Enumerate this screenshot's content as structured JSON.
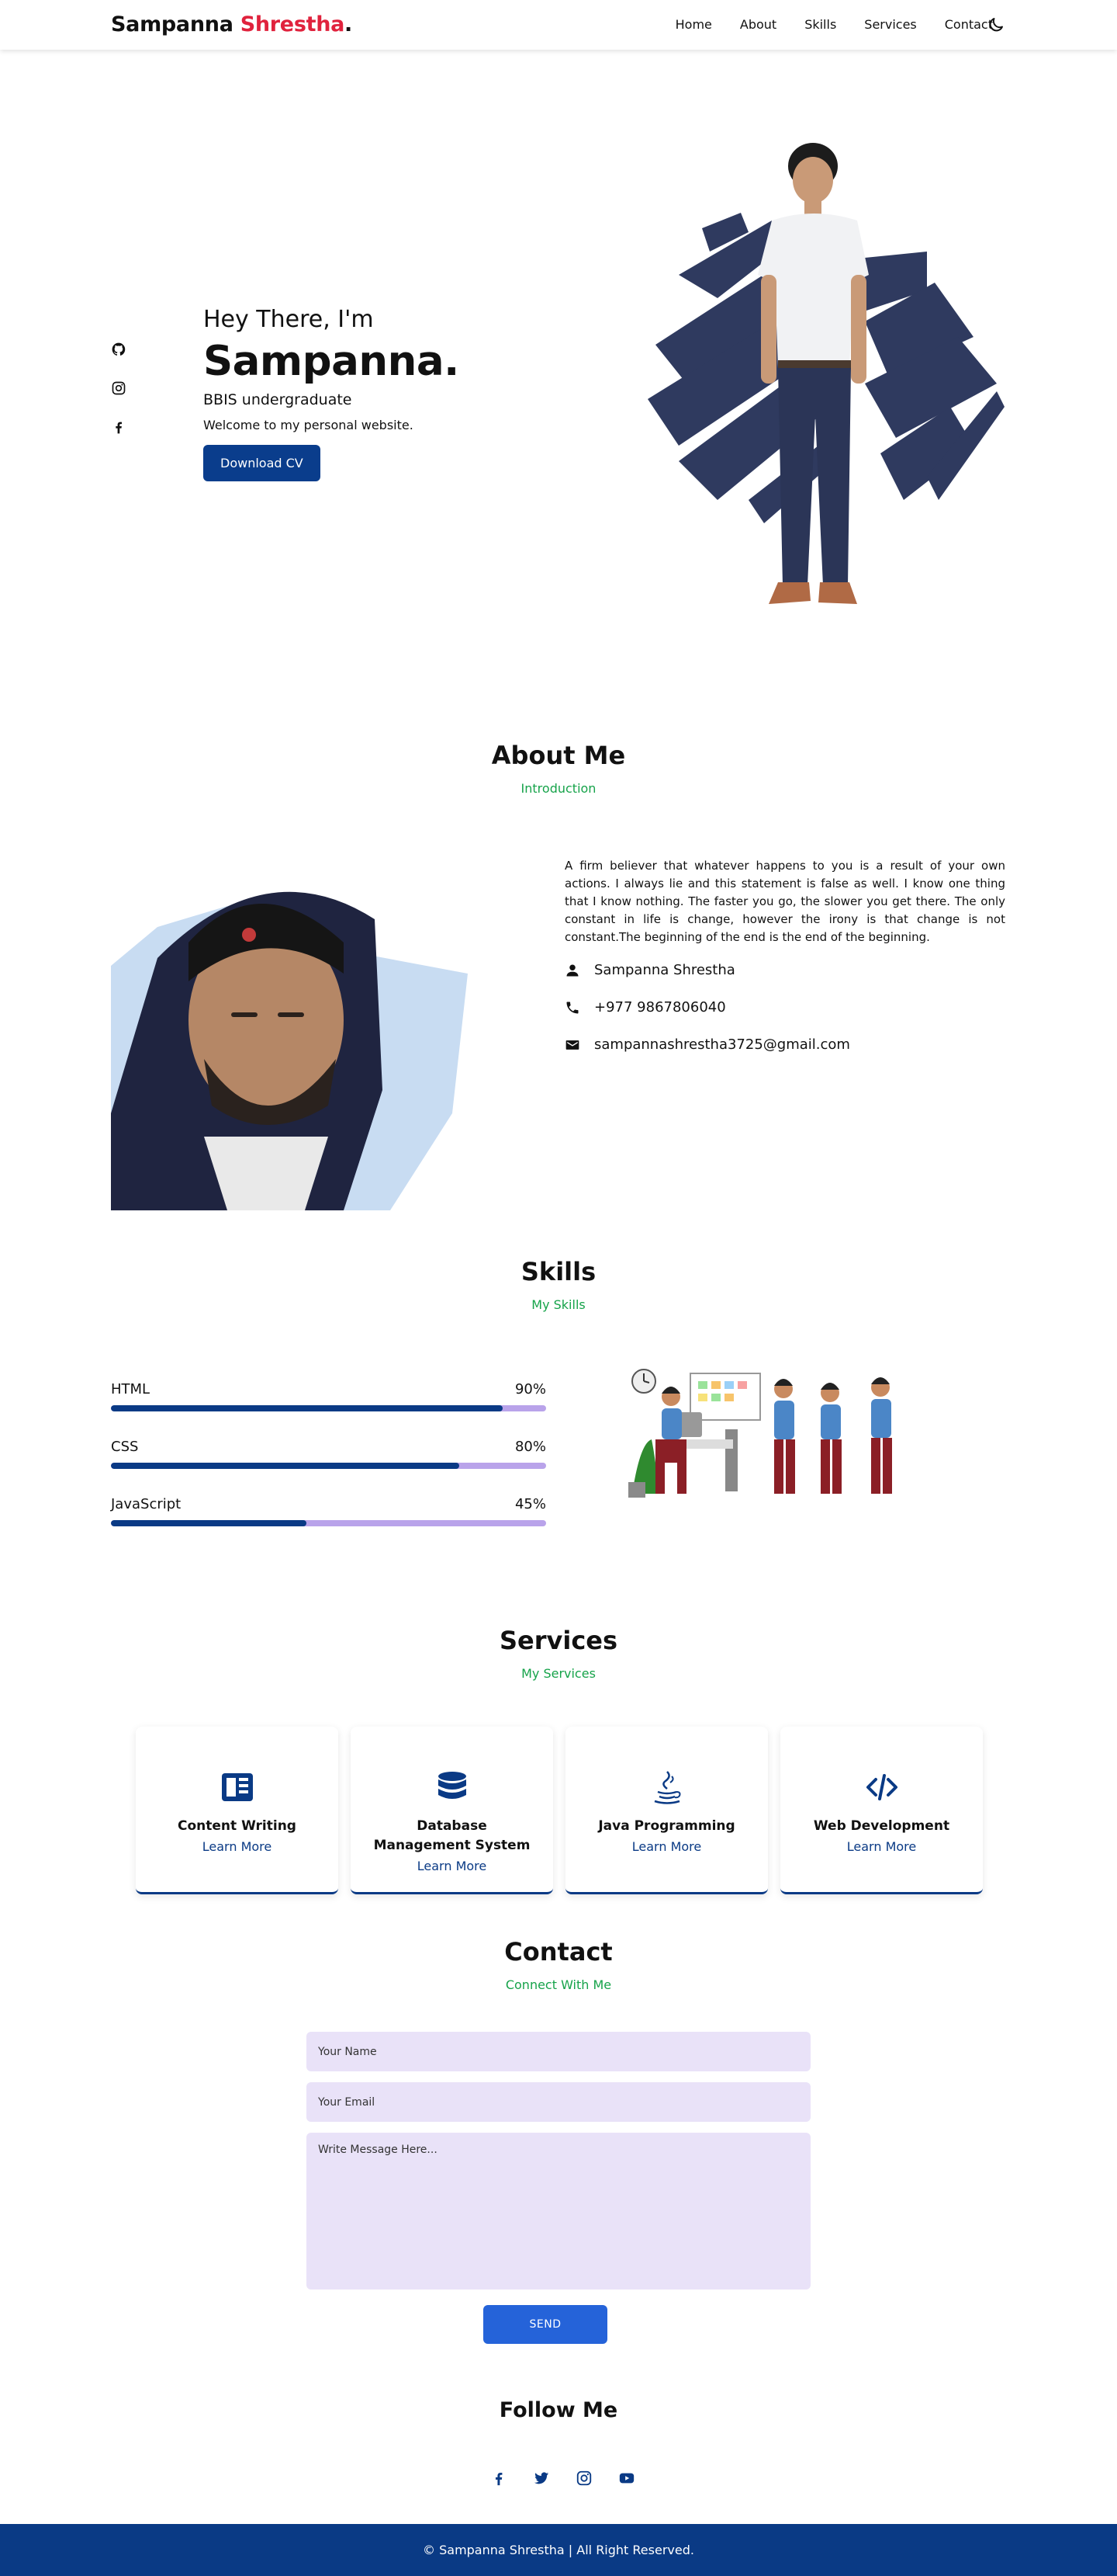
{
  "header": {
    "logo_first": "Sampanna",
    "logo_last": "Shrestha",
    "logo_dot": ".",
    "nav": [
      "Home",
      "About",
      "Skills",
      "Services",
      "Contact"
    ]
  },
  "hero": {
    "greeting": "Hey There, I'm",
    "name": "Sampanna.",
    "subtitle": "BBIS undergraduate",
    "welcome": "Welcome to my personal website.",
    "cv_button": "Download CV"
  },
  "about": {
    "title": "About Me",
    "subtitle": "Introduction",
    "bio": "A firm believer that whatever happens to you is a result of your own actions. I always lie and this statement is false as well. I know one thing that I know nothing. The faster you go, the slower you get there. The only constant in life is change, however the irony is that change is not constant.The beginning of the end is the end of the beginning.",
    "name": "Sampanna Shrestha",
    "phone": "+977 9867806040",
    "email": "sampannashrestha3725@gmail.com"
  },
  "skills": {
    "title": "Skills",
    "subtitle": "My Skills",
    "items": [
      {
        "name": "HTML",
        "percent": "90%",
        "value": 0.9
      },
      {
        "name": "CSS",
        "percent": "80%",
        "value": 0.8
      },
      {
        "name": "JavaScript",
        "percent": "45%",
        "value": 0.45
      }
    ]
  },
  "services": {
    "title": "Services",
    "subtitle": "My Services",
    "items": [
      {
        "title": "Content Writing",
        "link": "Learn More",
        "icon": "newspaper-icon"
      },
      {
        "title": "Database Management System",
        "link": "Learn More",
        "icon": "database-icon"
      },
      {
        "title": "Java Programming",
        "link": "Learn More",
        "icon": "java-icon"
      },
      {
        "title": "Web Development",
        "link": "Learn More",
        "icon": "code-icon"
      }
    ]
  },
  "contact": {
    "title": "Contact",
    "subtitle": "Connect With Me",
    "name_placeholder": "Your Name",
    "email_placeholder": "Your Email",
    "message_placeholder": "Write Message Here...",
    "send": "SEND"
  },
  "follow": {
    "title": "Follow Me"
  },
  "footer": {
    "text": "© Sampanna Shrestha | All Right Reserved."
  },
  "colors": {
    "accent_red": "#e0223d",
    "primary_navy": "#0a3a85",
    "subtitle_green": "#16a34a",
    "skill_track": "#b9a3ea",
    "field_bg": "#e9e2f8",
    "send_blue": "#2563d9"
  }
}
